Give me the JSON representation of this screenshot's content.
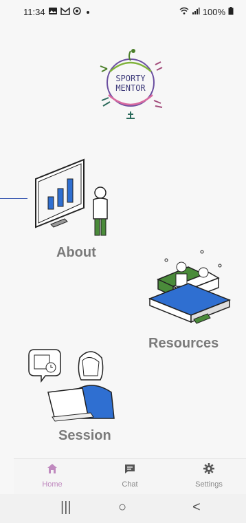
{
  "status_bar": {
    "time": "11:34",
    "battery": "100%"
  },
  "logo": {
    "line1": "SPORTY",
    "line2": "MENTOR",
    "icon": "sporty-mentor-logo"
  },
  "main": {
    "cards": [
      {
        "label": "About",
        "icon": "presentation-chart-icon"
      },
      {
        "label": "Resources",
        "icon": "books-stack-icon"
      },
      {
        "label": "Session",
        "icon": "laptop-user-icon"
      }
    ]
  },
  "bottom_nav": {
    "items": [
      {
        "label": "Home",
        "icon": "home-icon",
        "active": true
      },
      {
        "label": "Chat",
        "icon": "chat-icon",
        "active": false
      },
      {
        "label": "Settings",
        "icon": "gear-icon",
        "active": false
      }
    ]
  },
  "system_nav": {
    "recent": "|||",
    "home": "○",
    "back": "<"
  },
  "colors": {
    "accent": "#c08abf",
    "label_gray": "#7a7a7a",
    "illustration_blue": "#2f6fd1",
    "illustration_green": "#4a8b3a"
  }
}
